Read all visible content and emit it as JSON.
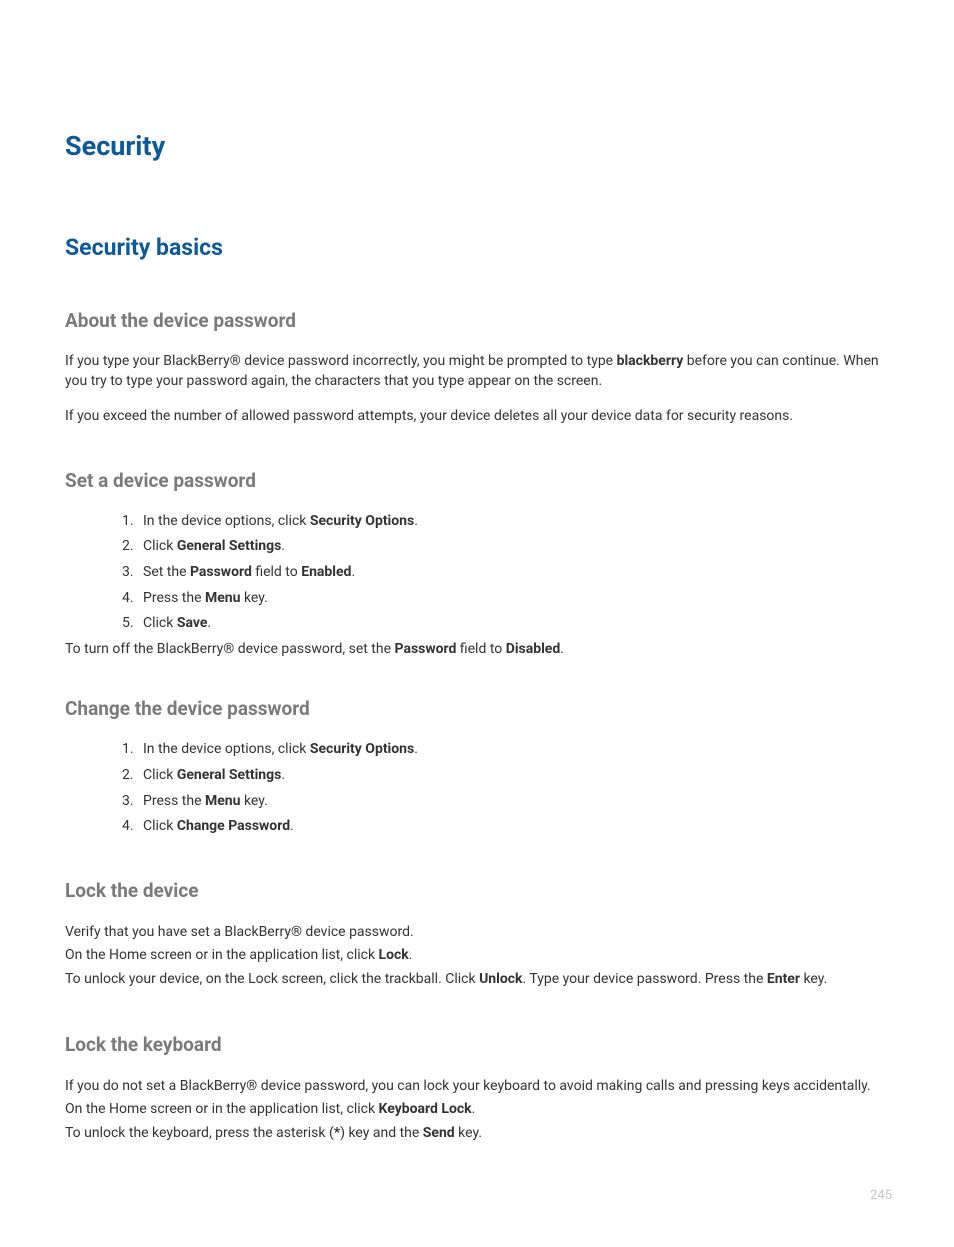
{
  "page_number": "245",
  "main_title": "Security",
  "section_title": "Security basics",
  "sub1": {
    "title": "About the device password",
    "p1_pre": "If you type your BlackBerry® device password incorrectly, you might be prompted to type ",
    "p1_bold": "blackberry",
    "p1_post": " before you can continue. When you try to type your password again, the characters that you type appear on the screen.",
    "p2": "If you exceed the number of allowed password attempts, your device deletes all your device data for security reasons."
  },
  "sub2": {
    "title": "Set a device password",
    "step1_pre": "In the device options, click ",
    "step1_bold": "Security Options",
    "step1_post": ".",
    "step2_pre": "Click ",
    "step2_bold": "General Settings",
    "step2_post": ".",
    "step3_pre": "Set the ",
    "step3_bold1": "Password",
    "step3_mid": " field to ",
    "step3_bold2": "Enabled",
    "step3_post": ".",
    "step4_pre": "Press the ",
    "step4_bold": "Menu",
    "step4_post": " key.",
    "step5_pre": "Click ",
    "step5_bold": "Save",
    "step5_post": ".",
    "followup_pre": "To turn off the BlackBerry® device password, set the ",
    "followup_bold1": "Password",
    "followup_mid": " field to ",
    "followup_bold2": "Disabled",
    "followup_post": "."
  },
  "sub3": {
    "title": "Change the device password",
    "step1_pre": "In the device options, click ",
    "step1_bold": "Security Options",
    "step1_post": ".",
    "step2_pre": "Click ",
    "step2_bold": "General Settings",
    "step2_post": ".",
    "step3_pre": "Press the ",
    "step3_bold": "Menu",
    "step3_post": " key.",
    "step4_pre": "Click ",
    "step4_bold": "Change Password",
    "step4_post": "."
  },
  "sub4": {
    "title": "Lock the device",
    "l1": "Verify that you have set a BlackBerry® device password.",
    "l2_pre": "On the Home screen or in the application list, click ",
    "l2_bold": "Lock",
    "l2_post": ".",
    "l3_pre": "To unlock your device, on the Lock screen, click the trackball. Click ",
    "l3_bold1": "Unlock",
    "l3_mid": ". Type your device password. Press the ",
    "l3_bold2": "Enter",
    "l3_post": " key."
  },
  "sub5": {
    "title": "Lock the keyboard",
    "l1": "If you do not set a BlackBerry® device password, you can lock your keyboard to avoid making calls and pressing keys accidentally.",
    "l2_pre": "On the Home screen or in the application list, click ",
    "l2_bold": "Keyboard Lock",
    "l2_post": ".",
    "l3_pre": "To unlock the keyboard, press the asterisk (",
    "l3_bold1": "*",
    "l3_mid": ") key and the ",
    "l3_bold2": "Send",
    "l3_post": " key."
  }
}
